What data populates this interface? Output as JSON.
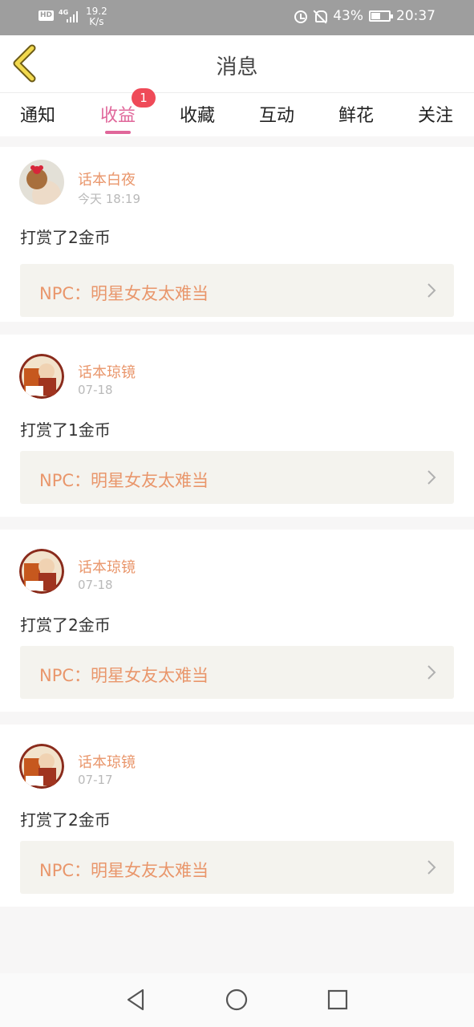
{
  "status_bar": {
    "hd": "HD",
    "network_gen": "4G",
    "speed_value": "19.2",
    "speed_unit": "K/s",
    "battery_percent": "43%",
    "time": "20:37"
  },
  "header": {
    "title": "消息",
    "back_icon": "chevron-left-icon"
  },
  "tabs": [
    {
      "label": "通知"
    },
    {
      "label": "收益",
      "active": true,
      "badge": "1"
    },
    {
      "label": "收藏"
    },
    {
      "label": "互动"
    },
    {
      "label": "鲜花"
    },
    {
      "label": "关注"
    }
  ],
  "messages": [
    {
      "user": "话本白夜",
      "time": "今天 18:19",
      "text": "打赏了2金币",
      "work": "NPC：明星女友太难当"
    },
    {
      "user": "话本琼镜",
      "time": "07-18",
      "text": "打赏了1金币",
      "work": "NPC：明星女友太难当"
    },
    {
      "user": "话本琼镜",
      "time": "07-18",
      "text": "打赏了2金币",
      "work": "NPC：明星女友太难当"
    },
    {
      "user": "话本琼镜",
      "time": "07-17",
      "text": "打赏了2金币",
      "work": "NPC：明星女友太难当"
    }
  ],
  "colors": {
    "accent": "#e0679a",
    "name": "#e9966b",
    "badge": "#ef4a58",
    "card_bg": "#f4f3ee"
  }
}
